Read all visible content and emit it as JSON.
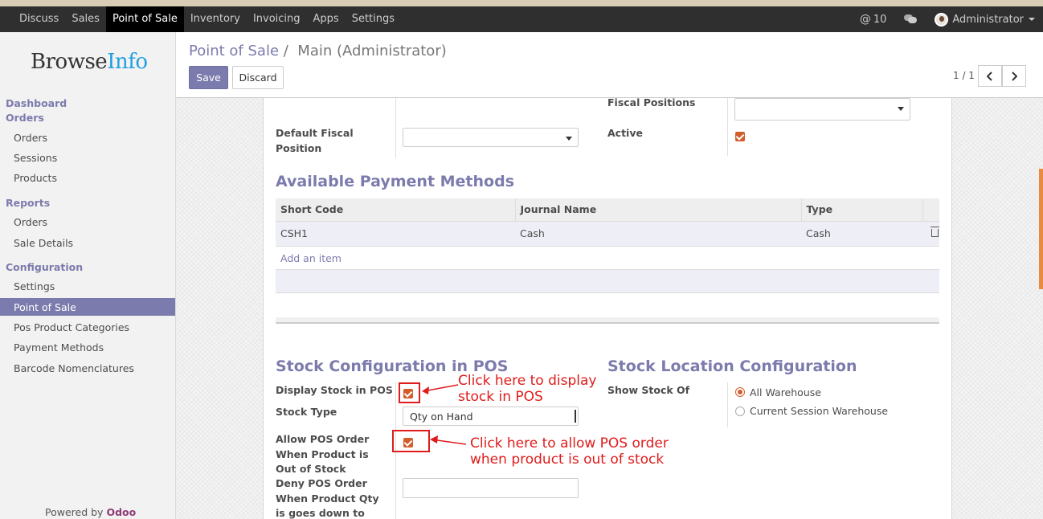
{
  "topbar": {
    "menu": [
      "Discuss",
      "Sales",
      "Point of Sale",
      "Inventory",
      "Invoicing",
      "Apps",
      "Settings"
    ],
    "active_index": 2,
    "mentions": "10",
    "user": "Administrator"
  },
  "sidebar": {
    "logo_main": "Browse",
    "logo_accent": "Info",
    "dashboard": "Dashboard",
    "orders_head": "Orders",
    "orders_items": [
      "Orders",
      "Sessions",
      "Products"
    ],
    "reports_head": "Reports",
    "reports_items": [
      "Orders",
      "Sale Details"
    ],
    "config_head": "Configuration",
    "config_items": [
      "Settings",
      "Point of Sale",
      "Pos Product Categories",
      "Payment Methods",
      "Barcode Nomenclatures"
    ],
    "powered_prefix": "Powered by",
    "powered_brand": "Odoo"
  },
  "cpanel": {
    "breadcrumb_link": "Point of Sale",
    "breadcrumb_sep": "/",
    "breadcrumb_current": "Main (Administrator)",
    "save": "Save",
    "discard": "Discard",
    "pager": "1 / 1"
  },
  "form": {
    "fiscal_positions_label": "Fiscal Positions",
    "default_fiscal_label": "Default Fiscal Position",
    "active_label": "Active",
    "active_checked": true,
    "payment_methods_title": "Available Payment Methods",
    "pm_columns": [
      "Short Code",
      "Journal Name",
      "Type"
    ],
    "pm_rows": [
      {
        "code": "CSH1",
        "journal": "Cash",
        "type": "Cash"
      }
    ],
    "add_item": "Add an item",
    "stock_title": "Stock Configuration in POS",
    "location_title": "Stock Location Configuration",
    "display_stock_label": "Display Stock in POS",
    "display_stock_checked": true,
    "stock_type_label": "Stock Type",
    "stock_type_value": "Qty on Hand",
    "allow_order_label": "Allow POS Order When Product is Out of Stock",
    "allow_order_checked": true,
    "deny_order_label": "Deny POS Order When Product Qty is goes down to",
    "show_stock_of_label": "Show Stock Of",
    "stock_of_options": [
      "All Warehouse",
      "Current Session Warehouse"
    ],
    "stock_of_selected": 0
  },
  "annotations": {
    "display_note_1": "Click here to display",
    "display_note_2": "stock in POS",
    "allow_note_1": "Click here to allow POS order",
    "allow_note_2": "when product is out of stock"
  },
  "colors": {
    "brand": "#7c7bad",
    "checkbox": "#d35c2b",
    "annotation": "#e01b1b",
    "navbar": "#2f2f2f"
  }
}
